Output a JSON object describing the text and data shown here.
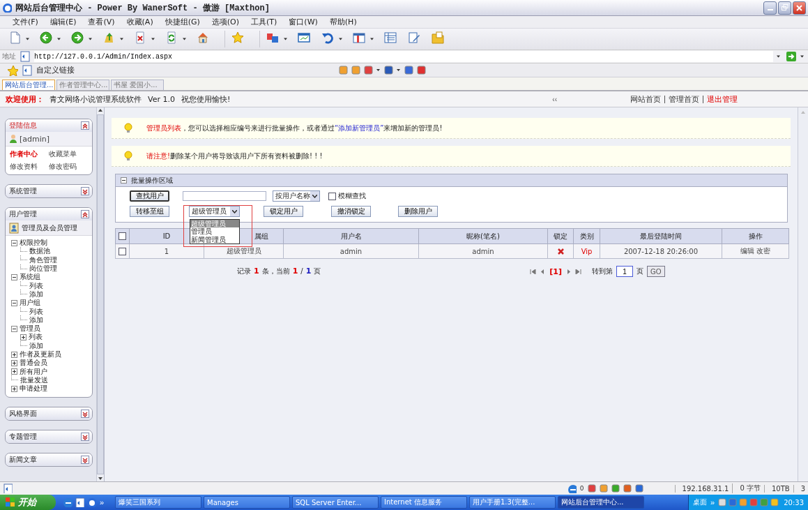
{
  "window": {
    "title": "网站后台管理中心 - Power By WanerSoft - 傲游 [Maxthon]"
  },
  "menu": [
    "文件(F)",
    "编辑(E)",
    "查看(V)",
    "收藏(A)",
    "快捷组(G)",
    "选项(O)",
    "工具(T)",
    "窗口(W)",
    "帮助(H)"
  ],
  "address": {
    "label": "地址",
    "value": "http://127.0.0.1/Admin/Index.aspx"
  },
  "links_bar": {
    "label": "自定义链接"
  },
  "browser_tabs": [
    {
      "label": "网站后台管理...",
      "selected": true
    },
    {
      "label": "作者管理中心...",
      "selected": false
    },
    {
      "label": "书屋 爱国小...",
      "selected": false
    }
  ],
  "welcome": {
    "label": "欢迎使用：",
    "product": "青文网络小说管理系统软件",
    "version": "Ver 1.0",
    "greeting": "祝您使用愉快!"
  },
  "collapse_toggle": "‹‹",
  "header_links": [
    {
      "label": "网站首页",
      "kind": "normal"
    },
    {
      "label": "管理首页",
      "kind": "normal"
    },
    {
      "label": "退出管理",
      "kind": "exit"
    }
  ],
  "sidebar": {
    "panels": [
      {
        "title": "登陆信息",
        "kind": "login",
        "expanded": true,
        "user": "[admin]",
        "links": [
          {
            "label": "作者中心",
            "highlight": true
          },
          {
            "label": "收藏菜单",
            "highlight": false
          },
          {
            "label": "修改资料",
            "highlight": false
          },
          {
            "label": "修改密码",
            "highlight": false
          }
        ]
      },
      {
        "title": "系统管理",
        "kind": "plain",
        "expanded": false
      },
      {
        "title": "用户管理",
        "kind": "tree",
        "expanded": true,
        "heading": "管理员及会员管理",
        "tree": [
          {
            "label": "权限控制",
            "expanded": true,
            "children": [
              {
                "label": "数据池"
              },
              {
                "label": "角色管理"
              },
              {
                "label": "岗位管理"
              }
            ]
          },
          {
            "label": "系统组",
            "expanded": true,
            "children": [
              {
                "label": "列表"
              },
              {
                "label": "添加"
              }
            ]
          },
          {
            "label": "用户组",
            "expanded": true,
            "children": [
              {
                "label": "列表"
              },
              {
                "label": "添加"
              }
            ]
          },
          {
            "label": "管理员",
            "expanded": true,
            "children": [
              {
                "label": "列表",
                "expanded": false
              },
              {
                "label": "添加"
              }
            ]
          },
          {
            "label": "作者及更新员",
            "expanded": false
          },
          {
            "label": "普通会员",
            "expanded": false
          },
          {
            "label": "所有用户",
            "expanded": false
          },
          {
            "label": "批量发送"
          },
          {
            "label": "申请处理",
            "expanded": false
          }
        ]
      },
      {
        "title": "风格界面",
        "kind": "plain",
        "expanded": false
      },
      {
        "title": "专题管理",
        "kind": "plain",
        "expanded": false
      },
      {
        "title": "新闻文章",
        "kind": "plain",
        "expanded": false
      }
    ]
  },
  "notices": [
    {
      "label": "管理员列表",
      "text": "，您可以选择相应编号来进行批量操作，或者通过",
      "link": "“添加新管理员”",
      "after": "来增加新的管理员!"
    },
    {
      "label": "请注意!",
      "text": "删除某个用户将导致该用户下所有资料被删除! ! !"
    }
  ],
  "batch": {
    "title": "批量操作区域",
    "expanded": true,
    "search_button": "查找用户",
    "search_by": "按用户名称",
    "fuzzy": {
      "label": "模糊查找",
      "checked": false
    },
    "move_button": "转移至组",
    "group_select": {
      "value": "超级管理员",
      "open": true,
      "options": [
        {
          "label": "超级管理员",
          "selected": true
        },
        {
          "label": "管理员",
          "selected": false
        },
        {
          "label": "新闻管理员",
          "selected": false
        }
      ]
    },
    "actions": [
      "锁定用户",
      "撤消锁定",
      "删除用户"
    ]
  },
  "table": {
    "select_all_checked": false,
    "columns": [
      "ID",
      "属组",
      "用户名",
      "昵称(笔名)",
      "锁定",
      "类别",
      "最后登陆时间",
      "操作"
    ],
    "rows": [
      {
        "checked": false,
        "id": "1",
        "group": "超级管理员",
        "username": "admin",
        "nickname": "admin",
        "locked": true,
        "type": "Vip",
        "last_login": "2007-12-18 20:26:00",
        "actions": [
          "编辑",
          "改密"
        ]
      }
    ]
  },
  "pager": {
    "summary": [
      {
        "kind": "text",
        "text": "记录"
      },
      {
        "kind": "red",
        "text": "1"
      },
      {
        "kind": "text",
        "text": "条，当前"
      },
      {
        "kind": "red",
        "text": "1"
      },
      {
        "kind": "text",
        "text": "/"
      },
      {
        "kind": "blue",
        "text": "1"
      },
      {
        "kind": "text",
        "text": "页"
      }
    ],
    "current_page": "[1]",
    "goto_label": "转到第",
    "goto_value": "1",
    "page_unit": "页",
    "go_button": "GO"
  },
  "status_bar": {
    "count": "0",
    "ip": "192.168.31.1",
    "bytes": "0 字节",
    "size": "10TB",
    "num": "3"
  },
  "taskbar": {
    "start": "开始",
    "overflow": "»",
    "tasks": [
      {
        "label": "爆笑三国系列",
        "selected": false
      },
      {
        "label": "Manages",
        "selected": false
      },
      {
        "label": "SQL Server Enter...",
        "selected": false
      },
      {
        "label": "Internet 信息服务",
        "selected": false
      },
      {
        "label": "用户手册1.3(完整...",
        "selected": false
      },
      {
        "label": "网站后台管理中心...",
        "selected": true
      }
    ],
    "desktop": "桌面",
    "desktop_overflow": "»",
    "clock": "20:33"
  }
}
